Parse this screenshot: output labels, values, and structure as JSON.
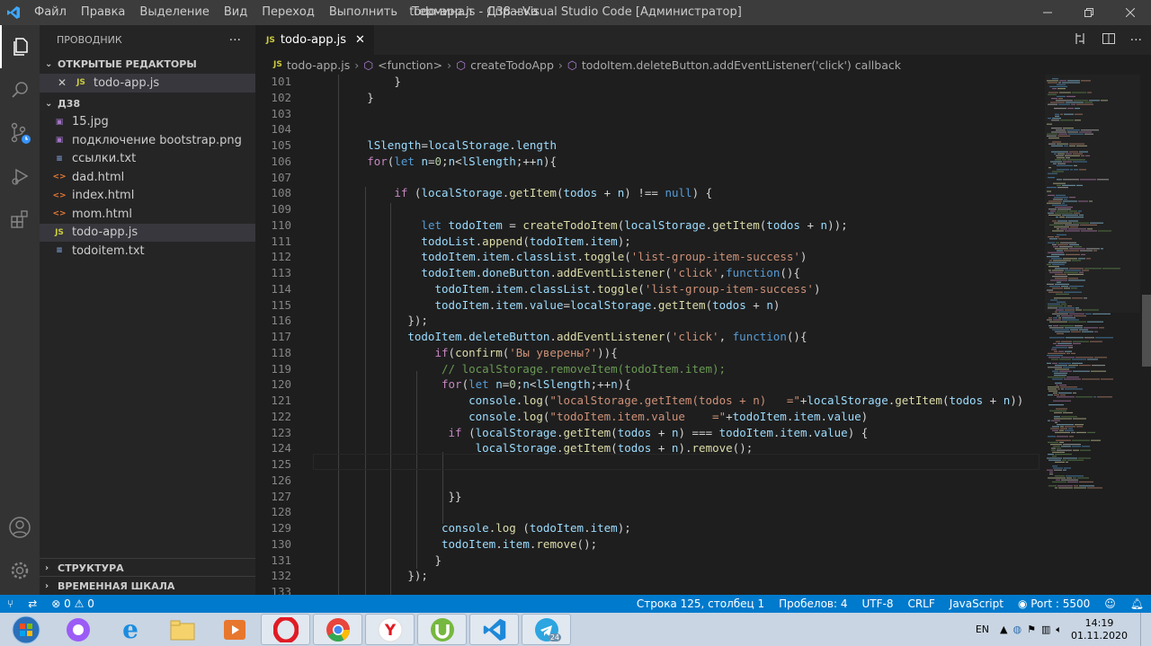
{
  "menu": [
    "Файл",
    "Правка",
    "Выделение",
    "Вид",
    "Переход",
    "Выполнить",
    "Терминал",
    "Справка"
  ],
  "window_title": "todo-app.js - Д38 - Visual Studio Code [Администратор]",
  "sidebar": {
    "title": "ПРОВОДНИК",
    "open_editors_label": "ОТКРЫТЫЕ РЕДАКТОРЫ",
    "open_editor_file": "todo-app.js",
    "folder_label": "Д38",
    "files": [
      {
        "name": "15.jpg",
        "type": "img"
      },
      {
        "name": "подключение bootstrap.png",
        "type": "img"
      },
      {
        "name": "ссылки.txt",
        "type": "txt"
      },
      {
        "name": "dad.html",
        "type": "html"
      },
      {
        "name": "index.html",
        "type": "html"
      },
      {
        "name": "mom.html",
        "type": "html"
      },
      {
        "name": "todo-app.js",
        "type": "js",
        "selected": true
      },
      {
        "name": "todoitem.txt",
        "type": "txt"
      }
    ],
    "outline_label": "СТРУКТУРА",
    "timeline_label": "ВРЕМЕННАЯ ШКАЛА"
  },
  "tab": {
    "label": "todo-app.js",
    "icon": "JS"
  },
  "breadcrumbs": [
    "todo-app.js",
    "<function>",
    "createTodoApp",
    "todoItem.deleteButton.addEventListener('click') callback"
  ],
  "code_lines": [
    {
      "n": "101",
      "t": "            }"
    },
    {
      "n": "102",
      "t": "        }"
    },
    {
      "n": "103",
      "t": ""
    },
    {
      "n": "104",
      "t": ""
    },
    {
      "n": "105",
      "t": "        lSlength=localStorage.length"
    },
    {
      "n": "106",
      "t": "        for(let n=0;n<lSlength;++n){"
    },
    {
      "n": "107",
      "t": ""
    },
    {
      "n": "108",
      "t": "            if (localStorage.getItem(todos + n) !== null) {"
    },
    {
      "n": "109",
      "t": ""
    },
    {
      "n": "110",
      "t": "                let todoItem = createTodoItem(localStorage.getItem(todos + n));"
    },
    {
      "n": "111",
      "t": "                todoList.append(todoItem.item);"
    },
    {
      "n": "112",
      "t": "                todoItem.item.classList.toggle('list-group-item-success')"
    },
    {
      "n": "113",
      "t": "                todoItem.doneButton.addEventListener('click',function(){"
    },
    {
      "n": "114",
      "t": "                  todoItem.item.classList.toggle('list-group-item-success')"
    },
    {
      "n": "115",
      "t": "                  todoItem.item.value=localStorage.getItem(todos + n)"
    },
    {
      "n": "116",
      "t": "              });"
    },
    {
      "n": "117",
      "t": "              todoItem.deleteButton.addEventListener('click', function(){"
    },
    {
      "n": "118",
      "t": "                  if(confirm('Вы уверены?')){"
    },
    {
      "n": "119",
      "t": "                   // localStorage.removeItem(todoItem.item);"
    },
    {
      "n": "120",
      "t": "                   for(let n=0;n<lSlength;++n){"
    },
    {
      "n": "121",
      "t": "                       console.log(\"localStorage.getItem(todos + n)   =\"+localStorage.getItem(todos + n))"
    },
    {
      "n": "122",
      "t": "                       console.log(\"todoItem.item.value    =\"+todoItem.item.value)"
    },
    {
      "n": "123",
      "t": "                    if (localStorage.getItem(todos + n) === todoItem.item.value) {"
    },
    {
      "n": "124",
      "t": "                        localStorage.getItem(todos + n).remove();"
    },
    {
      "n": "125",
      "t": ""
    },
    {
      "n": "126",
      "t": ""
    },
    {
      "n": "127",
      "t": "                    }}"
    },
    {
      "n": "128",
      "t": ""
    },
    {
      "n": "129",
      "t": "                   console.log (todoItem.item);"
    },
    {
      "n": "130",
      "t": "                   todoItem.item.remove();"
    },
    {
      "n": "131",
      "t": "                  }"
    },
    {
      "n": "132",
      "t": "              });"
    },
    {
      "n": "133",
      "t": ""
    }
  ],
  "status": {
    "problems": "0",
    "warnings": "0",
    "position": "Строка 125, столбец 1",
    "spaces": "Пробелов: 4",
    "encoding": "UTF-8",
    "eol": "CRLF",
    "language": "JavaScript",
    "port": "Port : 5500"
  },
  "taskbar": {
    "lang": "EN",
    "time": "14:19",
    "date": "01.11.2020",
    "telegram_badge": "24"
  },
  "colors": {
    "statusbar": "#007acc",
    "activitybar": "#333333",
    "sidebar": "#252526",
    "editor": "#1e1e1e"
  }
}
